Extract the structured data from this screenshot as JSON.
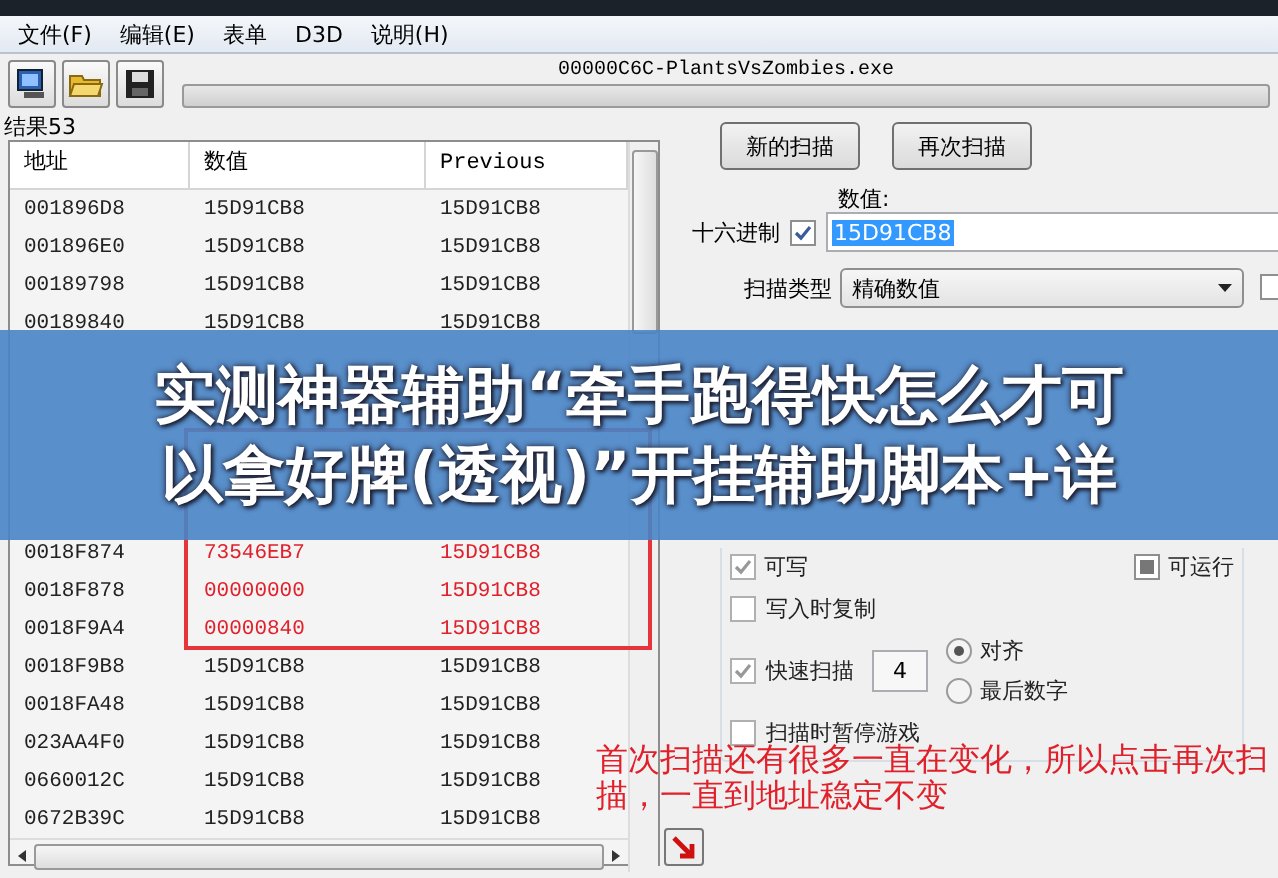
{
  "menu": [
    {
      "label": "文件(F)"
    },
    {
      "label": "编辑(E)"
    },
    {
      "label": "表单"
    },
    {
      "label": "D3D"
    },
    {
      "label": "说明(H)"
    }
  ],
  "toolbar": {
    "process": "00000C6C-PlantsVsZombies.exe"
  },
  "results_label": "结果53",
  "table": {
    "columns": [
      "地址",
      "数值",
      "Previous"
    ],
    "rows_top": [
      {
        "address": "001896D8",
        "value": "15D91CB8",
        "previous": "15D91CB8",
        "changed": false
      },
      {
        "address": "001896E0",
        "value": "15D91CB8",
        "previous": "15D91CB8",
        "changed": false
      },
      {
        "address": "00189798",
        "value": "15D91CB8",
        "previous": "15D91CB8",
        "changed": false
      },
      {
        "address": "00189840",
        "value": "15D91CB8",
        "previous": "15D91CB8",
        "changed": false
      }
    ],
    "rows_bottom": [
      {
        "address": "0018F874",
        "value": "73546EB7",
        "previous": "15D91CB8",
        "changed": true
      },
      {
        "address": "0018F878",
        "value": "00000000",
        "previous": "15D91CB8",
        "changed": true
      },
      {
        "address": "0018F9A4",
        "value": "00000840",
        "previous": "15D91CB8",
        "changed": true
      },
      {
        "address": "0018F9B8",
        "value": "15D91CB8",
        "previous": "15D91CB8",
        "changed": false
      },
      {
        "address": "0018FA48",
        "value": "15D91CB8",
        "previous": "15D91CB8",
        "changed": false
      },
      {
        "address": "023AA4F0",
        "value": "15D91CB8",
        "previous": "15D91CB8",
        "changed": false
      },
      {
        "address": "0660012C",
        "value": "15D91CB8",
        "previous": "15D91CB8",
        "changed": false
      },
      {
        "address": "0672B39C",
        "value": "15D91CB8",
        "previous": "15D91CB8",
        "changed": false
      }
    ]
  },
  "scan": {
    "buttons": [
      "新的扫描",
      "再次扫描"
    ],
    "value_label": "数值:",
    "hex": {
      "label": "十六进制",
      "checked": true
    },
    "value": "15D91CB8",
    "scan_type_label": "扫描类型",
    "scan_type": "精确数值",
    "scan_type_extra_checked": false
  },
  "options": {
    "writable": {
      "label": "可写",
      "checked": true
    },
    "executable": {
      "label": "可运行",
      "indeterminate": true
    },
    "copy_on_write": {
      "label": "写入时复制",
      "checked": false
    },
    "fast_scan": {
      "label": "快速扫描",
      "checked": true,
      "value": "4",
      "radios": [
        {
          "label": "对齐",
          "selected": true
        },
        {
          "label": "最后数字",
          "selected": false
        }
      ]
    },
    "pause": {
      "label": "扫描时暂停游戏",
      "checked": false
    }
  },
  "annotation": "首次扫描还有很多一直在变化，所以点击再次扫描，一直到地址稳定不变",
  "caption_lines": [
    "实测神器辅助“牵手跑得快怎么才可",
    "以拿好牌(透视)”开挂辅助脚本+详"
  ]
}
